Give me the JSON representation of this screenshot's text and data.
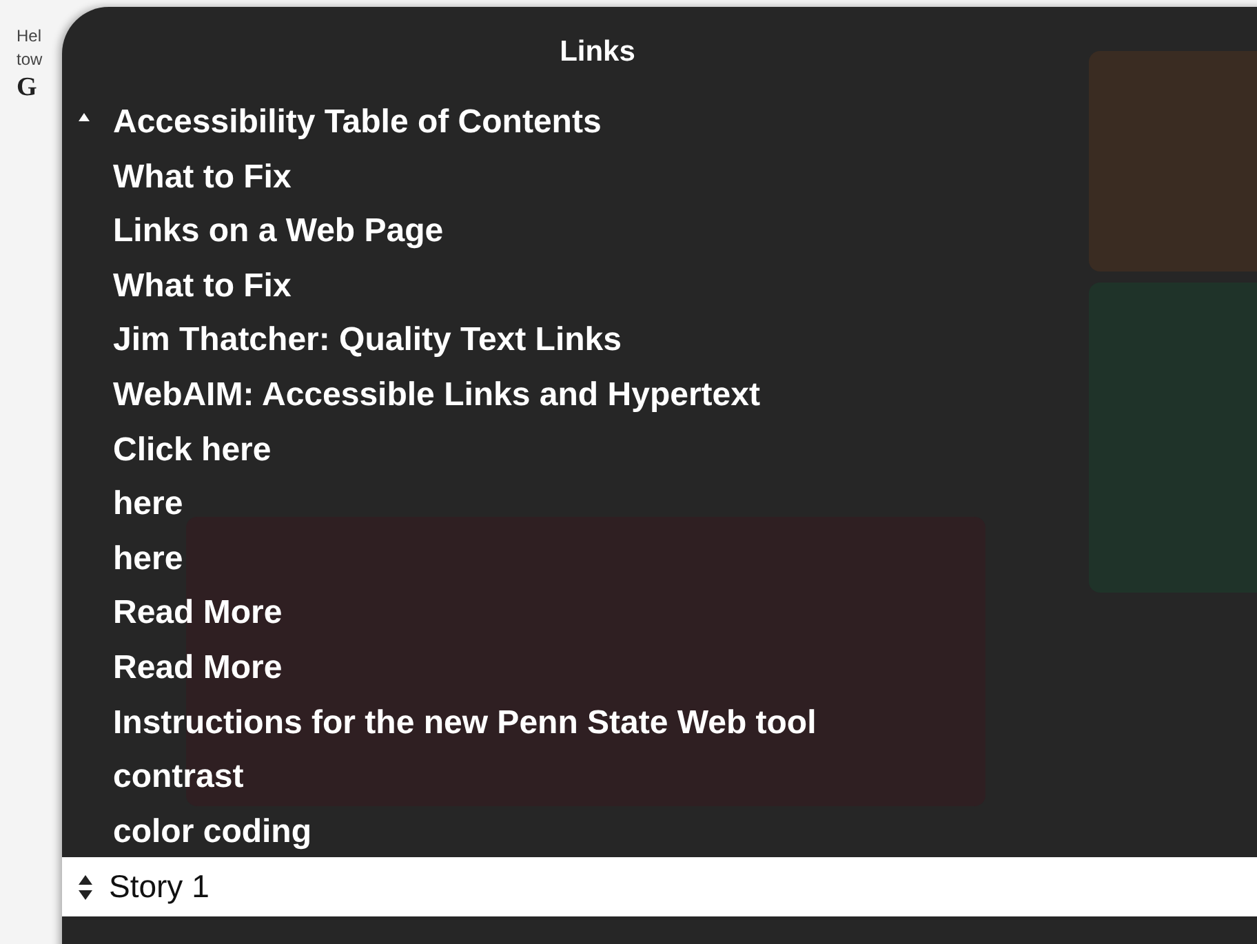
{
  "page_fragments": [
    "Hel",
    "tow",
    "G"
  ],
  "rotor": {
    "title": "Links",
    "items": [
      "Accessibility Table of Contents",
      "What to Fix",
      "Links on a Web Page",
      "What to Fix",
      "Jim Thatcher: Quality Text Links",
      "WebAIM: Accessible Links and Hypertext",
      "Click here",
      "here",
      "here",
      "Read More",
      "Read More",
      "Instructions for the new Penn State Web tool",
      "contrast",
      "color coding"
    ],
    "story": "Story 1"
  }
}
